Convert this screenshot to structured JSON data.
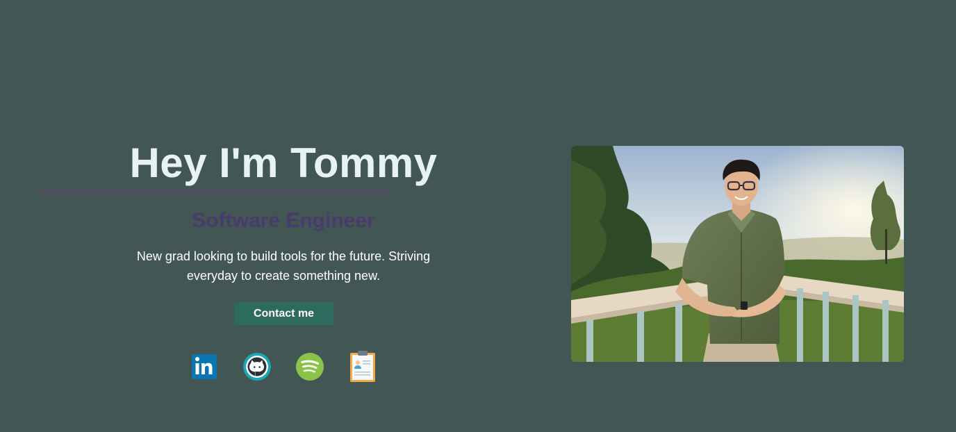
{
  "hero": {
    "title": "Hey I'm Tommy",
    "subtitle": "Software Engineer",
    "description": "New grad looking to build tools for the future. Striving everyday to create something new.",
    "contact_button_label": "Contact me"
  },
  "socials": [
    {
      "name": "LinkedIn",
      "icon": "linkedin-icon"
    },
    {
      "name": "GitHub",
      "icon": "github-icon"
    },
    {
      "name": "Spotify",
      "icon": "spotify-icon"
    },
    {
      "name": "Resume",
      "icon": "resume-clipboard-icon"
    }
  ],
  "photo": {
    "description_icon": "profile-photo"
  },
  "colors": {
    "background": "#425754",
    "title": "#e8f2f4",
    "subtitle": "#4b3a6e",
    "button": "#2c6b5e",
    "underline": "#5b4a6b"
  }
}
